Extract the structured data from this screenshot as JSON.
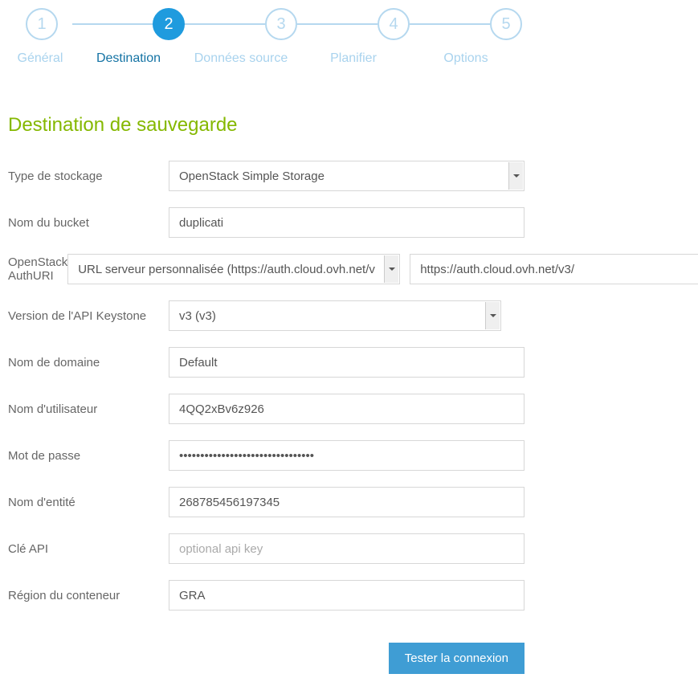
{
  "steps": [
    {
      "num": "1",
      "label": "Général"
    },
    {
      "num": "2",
      "label": "Destination"
    },
    {
      "num": "3",
      "label": "Données source"
    },
    {
      "num": "4",
      "label": "Planifier"
    },
    {
      "num": "5",
      "label": "Options"
    }
  ],
  "section_title": "Destination de sauvegarde",
  "fields": {
    "storage_type": {
      "label": "Type de stockage",
      "value": "OpenStack Simple Storage"
    },
    "bucket": {
      "label": "Nom du bucket",
      "value": "duplicati"
    },
    "authuri": {
      "label": "OpenStack AuthURI",
      "value": "URL serveur personnalisée (https://auth.cloud.ovh.net/v",
      "custom": "https://auth.cloud.ovh.net/v3/"
    },
    "keystone": {
      "label": "Version de l'API Keystone",
      "value": "v3 (v3)"
    },
    "domain": {
      "label": "Nom de domaine",
      "value": "Default"
    },
    "user": {
      "label": "Nom d'utilisateur",
      "value": "4QQ2xBv6z926"
    },
    "password": {
      "label": "Mot de passe",
      "value": "••••••••••••••••••••••••••••••••"
    },
    "entity": {
      "label": "Nom d'entité",
      "value": "268785456197345"
    },
    "apikey": {
      "label": "Clé API",
      "placeholder": "optional api key"
    },
    "region": {
      "label": "Région du conteneur",
      "value": "GRA"
    }
  },
  "buttons": {
    "test": "Tester la connexion"
  }
}
